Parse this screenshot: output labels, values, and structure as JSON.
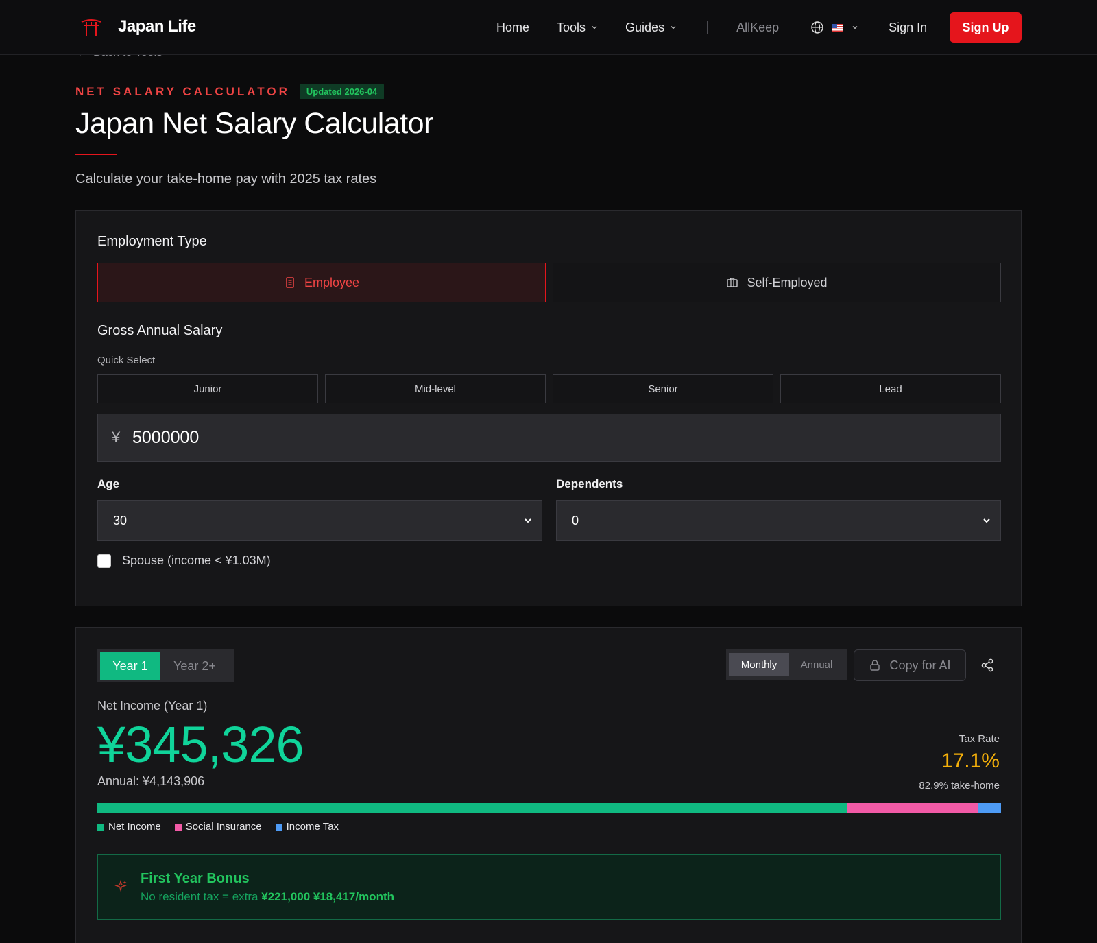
{
  "nav": {
    "brand": "Japan Life",
    "links": [
      {
        "label": "Home"
      },
      {
        "label": "Tools"
      },
      {
        "label": "Guides"
      }
    ],
    "allkeep": "AllKeep",
    "sign_in": "Sign In",
    "sign_up": "Sign Up"
  },
  "back_link": "Back to Tools",
  "header": {
    "eyebrow": "NET SALARY CALCULATOR",
    "updated": "Updated 2026-04",
    "title": "Japan Net Salary Calculator",
    "subtitle": "Calculate your take-home pay with 2025 tax rates"
  },
  "form": {
    "employment_type_label": "Employment Type",
    "employee_label": "Employee",
    "self_employed_label": "Self-Employed",
    "gross_salary_label": "Gross Annual Salary",
    "quick_select_label": "Quick Select",
    "quick_options": [
      "Junior",
      "Mid-level",
      "Senior",
      "Lead"
    ],
    "currency_symbol": "¥",
    "salary_value": "5000000",
    "age_label": "Age",
    "age_value": "30",
    "dependents_label": "Dependents",
    "dependents_value": "0",
    "spouse_label": "Spouse (income < ¥1.03M)"
  },
  "result": {
    "year1": "Year 1",
    "year2": "Year 2+",
    "monthly": "Monthly",
    "annual": "Annual",
    "copy_ai": "Copy for AI",
    "net_label": "Net Income (Year 1)",
    "net_value": "¥345,326",
    "annual_line": "Annual: ¥4,143,906",
    "tax_rate_label": "Tax Rate",
    "tax_rate_value": "17.1%",
    "take_home": "82.9% take-home",
    "breakdown": [
      {
        "label": "Net Income",
        "percent": 82.9,
        "color": "#10b981"
      },
      {
        "label": "Social Insurance",
        "percent": 14.5,
        "color": "#f25aa6"
      },
      {
        "label": "Income Tax",
        "percent": 2.6,
        "color": "#4e9bf5"
      }
    ],
    "bonus_title": "First Year Bonus",
    "bonus_prefix": "No resident tax = extra",
    "bonus_amount": "¥221,000",
    "bonus_monthly": "¥18,417/month"
  },
  "colors": {
    "accent_red": "#e5151c",
    "accent_green": "#10b981",
    "tax_rate": "#f6b10a"
  }
}
